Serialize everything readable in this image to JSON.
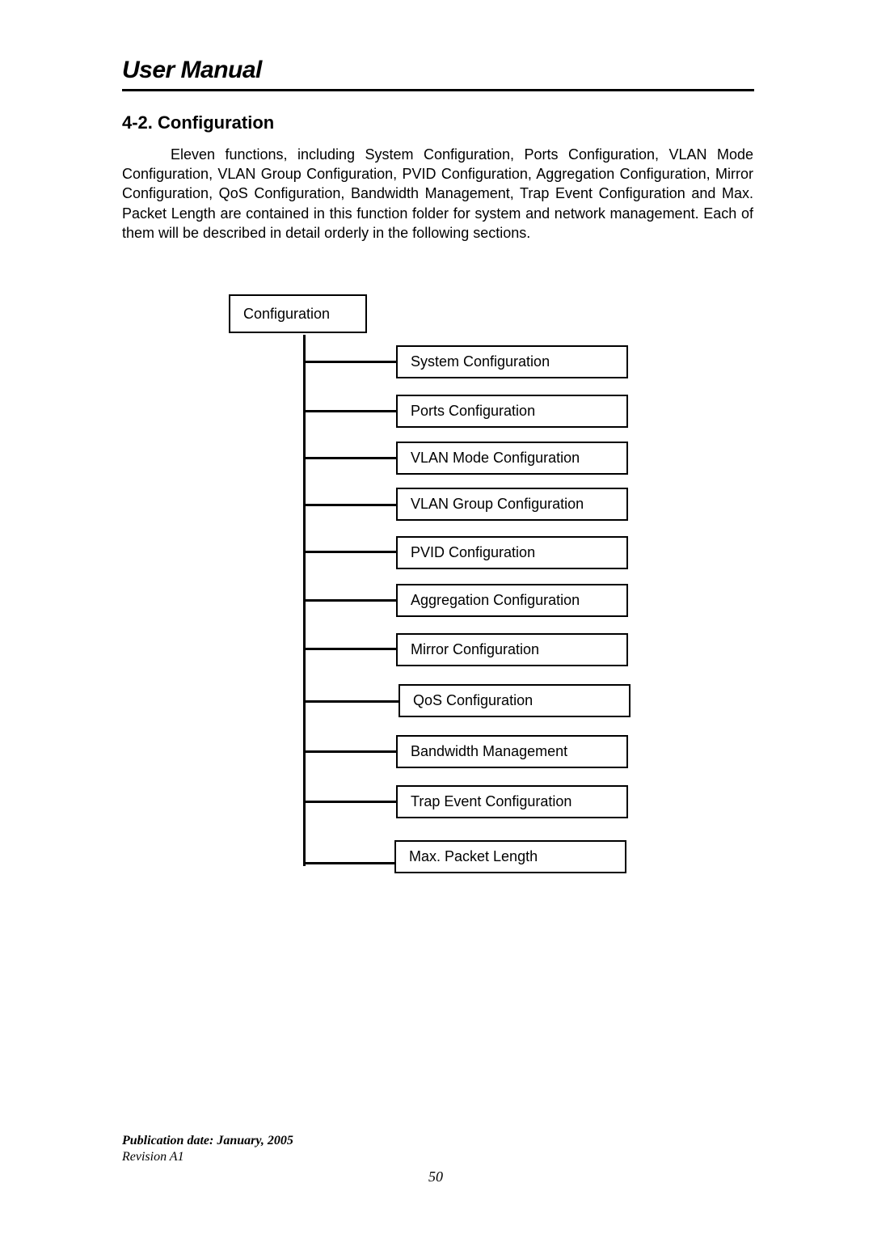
{
  "header": {
    "title": "User Manual"
  },
  "section": {
    "title": "4-2. Configuration",
    "paragraph": "Eleven functions, including System Configuration, Ports Configuration, VLAN Mode Configuration, VLAN Group Configuration, PVID Configuration, Aggregation Configuration, Mirror Configuration, QoS Configuration, Bandwidth Management, Trap Event Configuration and Max. Packet Length are contained in this function folder for system and network management. Each of them will be described in detail orderly in the following sections."
  },
  "diagram": {
    "root": "Configuration",
    "children": [
      "System Configuration",
      "Ports Configuration",
      "VLAN Mode Configuration",
      "VLAN Group Configuration",
      "PVID Configuration",
      "Aggregation Configuration",
      "Mirror Configuration",
      "QoS Configuration",
      "Bandwidth Management",
      "Trap Event Configuration",
      "Max. Packet Length"
    ]
  },
  "footer": {
    "publication": "Publication date: January, 2005",
    "revision": "Revision A1",
    "page_number": "50"
  }
}
